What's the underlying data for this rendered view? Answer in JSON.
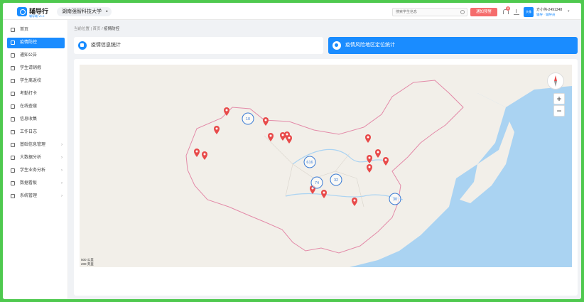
{
  "app": {
    "title": "辅导行",
    "version": "辅导端 V1.0",
    "school": "湖南强智科技大学"
  },
  "header": {
    "search_placeholder": "搜索学生信息",
    "report_button": "通知预警",
    "notification_count": "8",
    "avatar_text": "头像",
    "user_name": "方小伟-2491348",
    "user_role": "辅导 · 辅导员"
  },
  "sidebar": {
    "items": [
      {
        "label": "首页",
        "active": false,
        "icon": "home-icon"
      },
      {
        "label": "疫情防控",
        "active": true,
        "icon": "shield-icon"
      },
      {
        "label": "通知公告",
        "active": false,
        "icon": "notice-icon"
      },
      {
        "label": "学生请销假",
        "active": false,
        "icon": "leave-icon"
      },
      {
        "label": "学生离返校",
        "active": false,
        "icon": "building-icon"
      },
      {
        "label": "考勤打卡",
        "active": false,
        "icon": "checkin-icon"
      },
      {
        "label": "在线查寝",
        "active": false,
        "icon": "dorm-icon"
      },
      {
        "label": "信息收集",
        "active": false,
        "icon": "collect-icon"
      },
      {
        "label": "工作日志",
        "active": false,
        "icon": "log-icon"
      },
      {
        "label": "基础信息管理",
        "active": false,
        "icon": "info-icon",
        "arrow": "›"
      },
      {
        "label": "大数据分析",
        "active": false,
        "icon": "analysis-icon",
        "arrow": "›"
      },
      {
        "label": "学生业务分析",
        "active": false,
        "icon": "business-icon",
        "arrow": "›"
      },
      {
        "label": "数据看板",
        "active": false,
        "icon": "dashboard-icon",
        "arrow": "›"
      },
      {
        "label": "系统管理",
        "active": false,
        "icon": "settings-icon",
        "arrow": "›"
      }
    ]
  },
  "breadcrumb": {
    "prefix": "当前位置",
    "home": "首页",
    "sep": "/",
    "current": "疫情防控"
  },
  "tabs": {
    "stats": "疫情信息统计",
    "risk": "疫情风险地区定位统计"
  },
  "map": {
    "clusters": [
      "10",
      "616",
      "74",
      "32",
      "30"
    ],
    "scale_metric": "500 公里",
    "scale_imperial": "200 英里",
    "zoom_in": "+",
    "zoom_out": "−",
    "colors": {
      "water": "#aad3f2",
      "land": "#f2efe9",
      "border": "#e38aa8",
      "marker": "#e84a4a",
      "cluster": "#3a7bd5"
    }
  }
}
